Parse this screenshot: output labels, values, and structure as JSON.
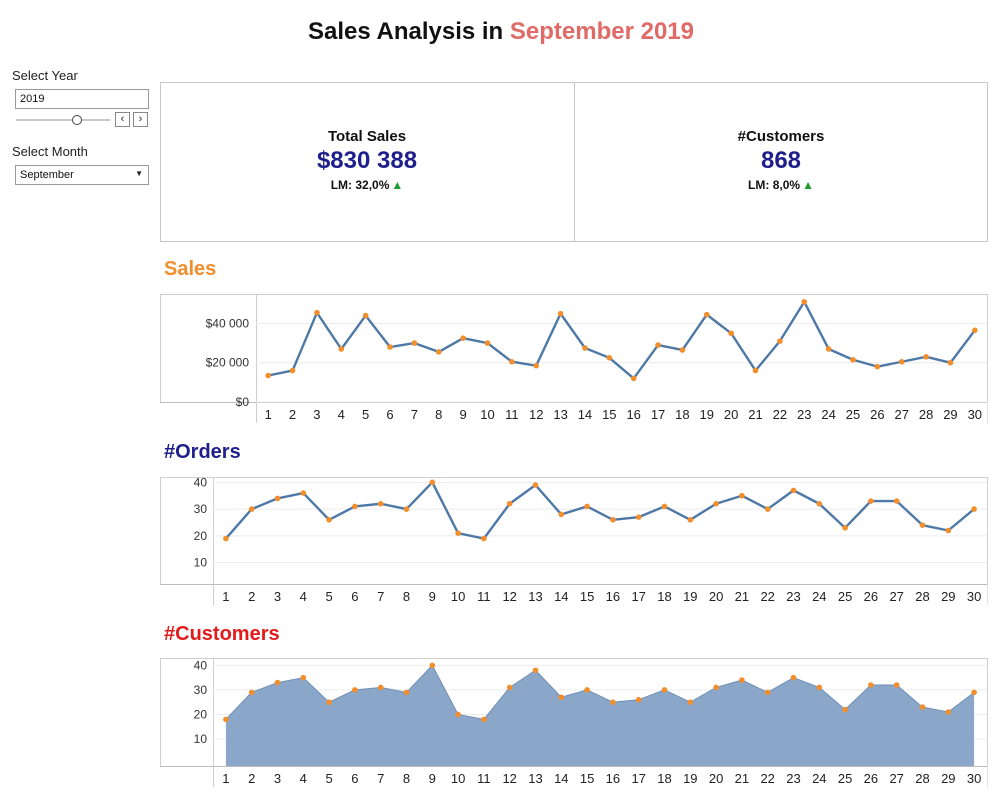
{
  "title": {
    "prefix": "Sales Analysis in ",
    "highlight": "September 2019"
  },
  "filters": {
    "year_label": "Select Year",
    "year_value": "2019",
    "month_label": "Select Month",
    "month_value": "September"
  },
  "kpis": [
    {
      "title": "Total Sales",
      "value": "$830 388",
      "sub": "LM: 32,0%"
    },
    {
      "title": "#Customers",
      "value": "868",
      "sub": "LM: 8,0%"
    }
  ],
  "colors": {
    "line": "#4e79a7",
    "marker": "#f28e2b",
    "area_fill": "#8aa6c8",
    "sales_title": "#f28e2b",
    "orders_title": "#1f1f8c",
    "customers_title": "#e11b1b",
    "kpi_value": "#1f1f8c",
    "up_arrow": "#1e9e2e"
  },
  "chart_data": [
    {
      "type": "line",
      "title": "Sales",
      "x": [
        1,
        2,
        3,
        4,
        5,
        6,
        7,
        8,
        9,
        10,
        11,
        12,
        13,
        14,
        15,
        16,
        17,
        18,
        19,
        20,
        21,
        22,
        23,
        24,
        25,
        26,
        27,
        28,
        29,
        30
      ],
      "series": [
        {
          "values": [
            13500,
            16000,
            45500,
            27000,
            44000,
            28000,
            30000,
            25500,
            32500,
            30000,
            20500,
            18500,
            45000,
            27500,
            22500,
            12000,
            29000,
            26500,
            44500,
            35000,
            16000,
            31000,
            51000,
            27000,
            21500,
            18000,
            20500,
            23000,
            20000,
            36500
          ]
        }
      ],
      "y_ticks": [
        "$0",
        "$20 000",
        "$40 000"
      ],
      "ylim": [
        0,
        55000
      ],
      "grid": true
    },
    {
      "type": "line",
      "title": "#Orders",
      "x": [
        1,
        2,
        3,
        4,
        5,
        6,
        7,
        8,
        9,
        10,
        11,
        12,
        13,
        14,
        15,
        16,
        17,
        18,
        19,
        20,
        21,
        22,
        23,
        24,
        25,
        26,
        27,
        28,
        29,
        30
      ],
      "series": [
        {
          "values": [
            19,
            30,
            34,
            36,
            26,
            31,
            32,
            30,
            40,
            21,
            19,
            32,
            39,
            28,
            31,
            26,
            27,
            31,
            26,
            32,
            35,
            30,
            37,
            32,
            23,
            33,
            33,
            24,
            22,
            30
          ]
        }
      ],
      "y_ticks": [
        "10",
        "20",
        "30",
        "40"
      ],
      "ylim": [
        2,
        42
      ],
      "grid": true
    },
    {
      "type": "area",
      "title": "#Customers",
      "x": [
        1,
        2,
        3,
        4,
        5,
        6,
        7,
        8,
        9,
        10,
        11,
        12,
        13,
        14,
        15,
        16,
        17,
        18,
        19,
        20,
        21,
        22,
        23,
        24,
        25,
        26,
        27,
        28,
        29,
        30
      ],
      "series": [
        {
          "values": [
            18,
            29,
            33,
            35,
            25,
            30,
            31,
            29,
            40,
            20,
            18,
            31,
            38,
            27,
            30,
            25,
            26,
            30,
            25,
            31,
            34,
            29,
            35,
            31,
            22,
            32,
            32,
            23,
            21,
            29
          ]
        }
      ],
      "y_ticks": [
        "10",
        "20",
        "30",
        "40"
      ],
      "ylim": [
        -1,
        43
      ],
      "grid": true
    }
  ]
}
